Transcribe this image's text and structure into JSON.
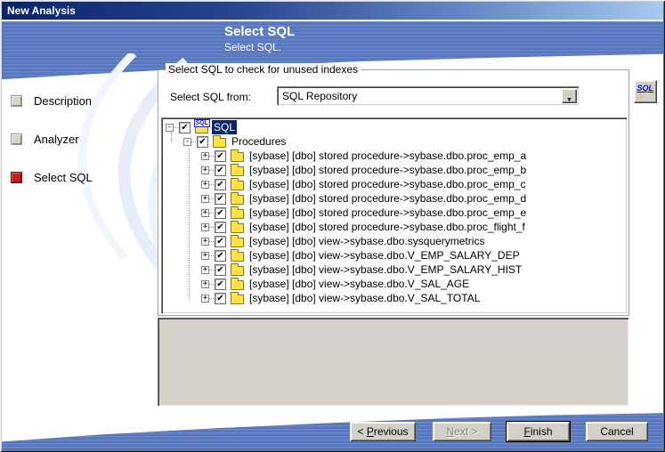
{
  "window": {
    "title": "New Analysis"
  },
  "header": {
    "title": "Select SQL",
    "subtitle": "Select SQL."
  },
  "steps": [
    {
      "label": "Description",
      "active": false
    },
    {
      "label": "Analyzer",
      "active": false
    },
    {
      "label": "Select SQL",
      "active": true
    }
  ],
  "panel": {
    "groupbox_title": "Select SQL to check for unused indexes",
    "select_label": "Select SQL from:",
    "select_value": "SQL Repository",
    "sql_root_badge": "SQL",
    "tree_rows": [
      {
        "level": 0,
        "expand": "minus",
        "checked": true,
        "selected": true,
        "icon": "sql-folder",
        "label": "SQL"
      },
      {
        "level": 1,
        "expand": "minus",
        "checked": true,
        "selected": false,
        "icon": "folder",
        "label": "Procedures"
      },
      {
        "level": 2,
        "expand": "plus",
        "checked": true,
        "selected": false,
        "icon": "folder",
        "label": "[sybase] [dbo] stored procedure->sybase.dbo.proc_emp_a"
      },
      {
        "level": 2,
        "expand": "plus",
        "checked": true,
        "selected": false,
        "icon": "folder",
        "label": "[sybase] [dbo] stored procedure->sybase.dbo.proc_emp_b"
      },
      {
        "level": 2,
        "expand": "plus",
        "checked": true,
        "selected": false,
        "icon": "folder",
        "label": "[sybase] [dbo] stored procedure->sybase.dbo.proc_emp_c"
      },
      {
        "level": 2,
        "expand": "plus",
        "checked": true,
        "selected": false,
        "icon": "folder",
        "label": "[sybase] [dbo] stored procedure->sybase.dbo.proc_emp_d"
      },
      {
        "level": 2,
        "expand": "plus",
        "checked": true,
        "selected": false,
        "icon": "folder",
        "label": "[sybase] [dbo] stored procedure->sybase.dbo.proc_emp_e"
      },
      {
        "level": 2,
        "expand": "plus",
        "checked": true,
        "selected": false,
        "icon": "folder",
        "label": "[sybase] [dbo] stored procedure->sybase.dbo.proc_flight_f"
      },
      {
        "level": 2,
        "expand": "plus",
        "checked": true,
        "selected": false,
        "icon": "folder",
        "label": "[sybase] [dbo] view->sybase.dbo.sysquerymetrics"
      },
      {
        "level": 2,
        "expand": "plus",
        "checked": true,
        "selected": false,
        "icon": "folder",
        "label": "[sybase] [dbo] view->sybase.dbo.V_EMP_SALARY_DEP"
      },
      {
        "level": 2,
        "expand": "plus",
        "checked": true,
        "selected": false,
        "icon": "folder",
        "label": "[sybase] [dbo] view->sybase.dbo.V_EMP_SALARY_HIST"
      },
      {
        "level": 2,
        "expand": "plus",
        "checked": true,
        "selected": false,
        "icon": "folder",
        "label": "[sybase] [dbo] view->sybase.dbo.V_SAL_AGE"
      },
      {
        "level": 2,
        "expand": "plus",
        "checked": true,
        "selected": false,
        "icon": "folder",
        "label": "[sybase] [dbo] view->sybase.dbo.V_SAL_TOTAL"
      }
    ]
  },
  "buttons": {
    "previous": {
      "label": "< Previous",
      "mnemonic": "P",
      "enabled": true,
      "default": false
    },
    "next": {
      "label": "Next >",
      "mnemonic": "N",
      "enabled": false,
      "default": false
    },
    "finish": {
      "label": "Finish",
      "mnemonic": "F",
      "enabled": true,
      "default": true
    },
    "cancel": {
      "label": "Cancel",
      "mnemonic": "",
      "enabled": true,
      "default": false
    }
  },
  "colors": {
    "titlebar_start": "#0a246a",
    "titlebar_end": "#a6caf0",
    "band_blue": "#5b7ac1",
    "step_active_red": "#c32222",
    "step_inactive_gray": "#d8d4cc",
    "selection_blue": "#0a246a",
    "folder_yellow": "#ffe24a",
    "preview_gray": "#d5d1c9",
    "button_face": "#d4d0c8"
  }
}
